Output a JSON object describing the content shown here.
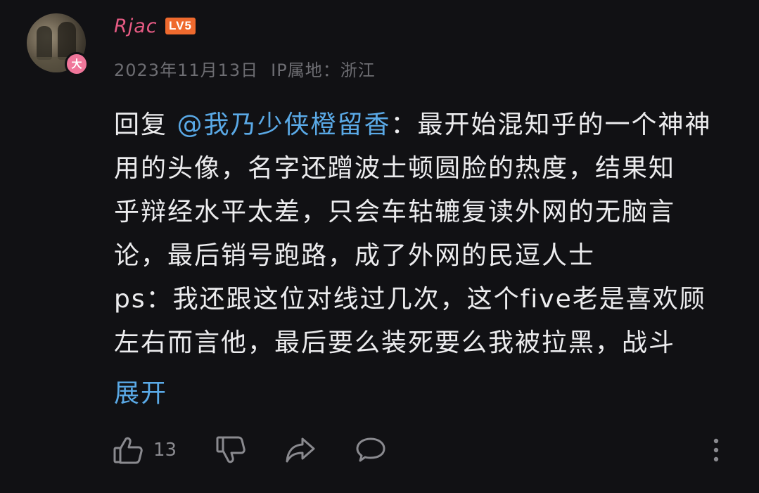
{
  "comment": {
    "username": "Rjac",
    "level": "LV5",
    "avatar_badge": "大",
    "date": "2023年11月13日",
    "ip_location": "IP属地：浙江",
    "reply_prefix": "回复 ",
    "mention": "@我乃少侠橙留香",
    "lines": [
      "：最开始混知乎的一个神神",
      "用的头像，名字还蹭波士顿圆脸的热度，结果知",
      "乎辩经水平太差，只会车轱辘复读外网的无脑言",
      "论，最后销号跑路，成了外网的民逗人士",
      "ps：我还跟这位对线过几次，这个five老是喜欢顾",
      "左右而言他，最后要么装死要么我被拉黑，战斗"
    ],
    "expand_label": "展开",
    "like_count": "13"
  },
  "colors": {
    "background": "#111114",
    "username": "#e75b84",
    "level_badge": "#ef6a2e",
    "link": "#5aa9e6",
    "text": "#ececee",
    "meta": "#6d6d72"
  },
  "icons": {
    "like": "thumbs-up-icon",
    "dislike": "thumbs-down-icon",
    "share": "share-icon",
    "comment": "comment-icon",
    "more": "more-vertical-icon"
  }
}
